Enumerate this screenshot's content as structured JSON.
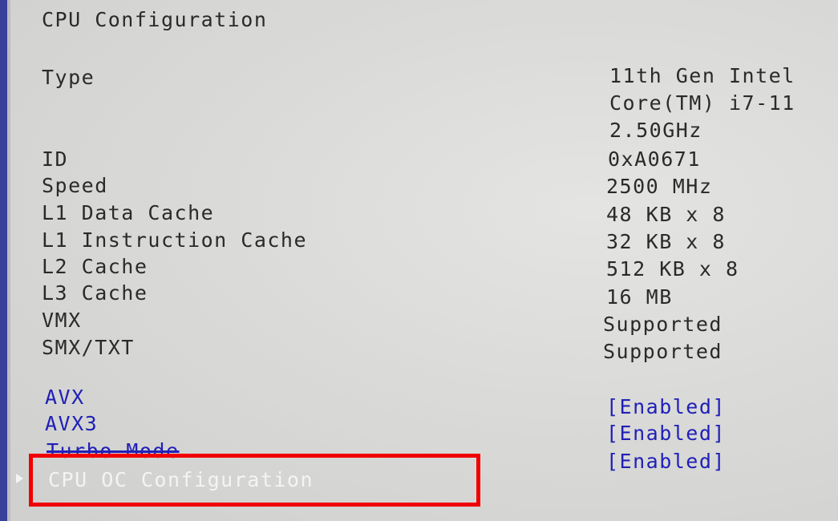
{
  "page": {
    "title": "CPU Configuration"
  },
  "info": [
    {
      "label": "Type",
      "value_lines": [
        "11th Gen Intel",
        "Core(TM) i7-11",
        "2.50GHz"
      ]
    },
    {
      "label": "ID",
      "value": "0xA0671"
    },
    {
      "label": "Speed",
      "value": "2500 MHz"
    },
    {
      "label": "L1 Data Cache",
      "value": "48 KB x 8"
    },
    {
      "label": "L1 Instruction Cache",
      "value": "32 KB x 8"
    },
    {
      "label": "L2 Cache",
      "value": "512 KB x 8"
    },
    {
      "label": "L3 Cache",
      "value": "16 MB"
    },
    {
      "label": "VMX",
      "value": "Supported"
    },
    {
      "label": "SMX/TXT",
      "value": "Supported"
    }
  ],
  "options": [
    {
      "label": "AVX",
      "value": "[Enabled]"
    },
    {
      "label": "AVX3",
      "value": "[Enabled]"
    },
    {
      "label": "Turbo Mode",
      "value": "[Enabled]"
    }
  ],
  "submenu": {
    "label": "CPU OC Configuration",
    "pointer_icon": "triangle-right-icon"
  },
  "colors": {
    "option_text": "#2020b8",
    "selected_text": "#f4f4f4",
    "highlight_box": "#f00000",
    "static_text": "#2a2a2a"
  }
}
